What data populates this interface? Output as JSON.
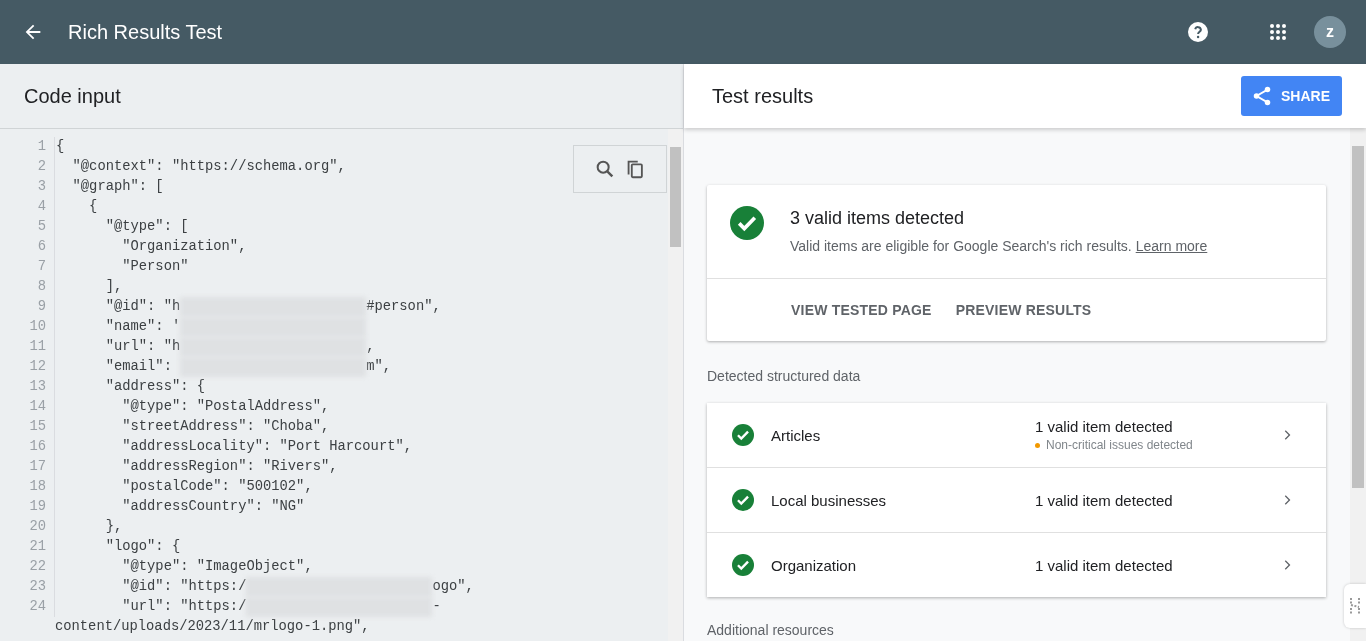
{
  "header": {
    "title": "Rich Results Test",
    "avatar": "z"
  },
  "code_panel": {
    "title": "Code input",
    "lines": [
      {
        "number": "1",
        "parts": [
          {
            "kind": "code",
            "text": "{"
          }
        ]
      },
      {
        "number": "2",
        "parts": [
          {
            "kind": "code",
            "text": "  \"@context\": \"https://schema.org\","
          }
        ]
      },
      {
        "number": "3",
        "parts": [
          {
            "kind": "code",
            "text": "  \"@graph\": ["
          }
        ]
      },
      {
        "number": "4",
        "parts": [
          {
            "kind": "code",
            "text": "    {"
          }
        ]
      },
      {
        "number": "5",
        "parts": [
          {
            "kind": "code",
            "text": "      \"@type\": ["
          }
        ]
      },
      {
        "number": "6",
        "parts": [
          {
            "kind": "code",
            "text": "        \"Organization\","
          }
        ]
      },
      {
        "number": "7",
        "parts": [
          {
            "kind": "code",
            "text": "        \"Person\""
          }
        ]
      },
      {
        "number": "8",
        "parts": [
          {
            "kind": "code",
            "text": "      ],"
          }
        ]
      },
      {
        "number": "9",
        "parts": [
          {
            "kind": "code",
            "text": "      \"@id\": \"h"
          },
          {
            "kind": "redacted"
          },
          {
            "kind": "code",
            "text": "#person\","
          }
        ]
      },
      {
        "number": "10",
        "parts": [
          {
            "kind": "code",
            "text": "      \"name\": '"
          },
          {
            "kind": "redacted"
          }
        ]
      },
      {
        "number": "11",
        "parts": [
          {
            "kind": "code",
            "text": "      \"url\": \"h"
          },
          {
            "kind": "redacted"
          },
          {
            "kind": "code",
            "text": ","
          }
        ]
      },
      {
        "number": "12",
        "parts": [
          {
            "kind": "code",
            "text": "      \"email\": "
          },
          {
            "kind": "redacted"
          },
          {
            "kind": "code",
            "text": "m\","
          }
        ]
      },
      {
        "number": "13",
        "parts": [
          {
            "kind": "code",
            "text": "      \"address\": {"
          }
        ]
      },
      {
        "number": "14",
        "parts": [
          {
            "kind": "code",
            "text": "        \"@type\": \"PostalAddress\","
          }
        ]
      },
      {
        "number": "15",
        "parts": [
          {
            "kind": "code",
            "text": "        \"streetAddress\": \"Choba\","
          }
        ]
      },
      {
        "number": "16",
        "parts": [
          {
            "kind": "code",
            "text": "        \"addressLocality\": \"Port Harcourt\","
          }
        ]
      },
      {
        "number": "17",
        "parts": [
          {
            "kind": "code",
            "text": "        \"addressRegion\": \"Rivers\","
          }
        ]
      },
      {
        "number": "18",
        "parts": [
          {
            "kind": "code",
            "text": "        \"postalCode\": \"500102\","
          }
        ]
      },
      {
        "number": "19",
        "parts": [
          {
            "kind": "code",
            "text": "        \"addressCountry\": \"NG\""
          }
        ]
      },
      {
        "number": "20",
        "parts": [
          {
            "kind": "code",
            "text": "      },"
          }
        ]
      },
      {
        "number": "21",
        "parts": [
          {
            "kind": "code",
            "text": "      \"logo\": {"
          }
        ]
      },
      {
        "number": "22",
        "parts": [
          {
            "kind": "code",
            "text": "        \"@type\": \"ImageObject\","
          }
        ]
      },
      {
        "number": "23",
        "parts": [
          {
            "kind": "code",
            "text": "        \"@id\": \"https:/"
          },
          {
            "kind": "redacted"
          },
          {
            "kind": "code",
            "text": "ogo\","
          }
        ]
      },
      {
        "number": "24",
        "parts": [
          {
            "kind": "code",
            "text": "        \"url\": \"https:/"
          },
          {
            "kind": "redacted"
          },
          {
            "kind": "code",
            "text": "-"
          }
        ],
        "wrap": "content/uploads/2023/11/mrlogo-1.png\","
      }
    ]
  },
  "results": {
    "title": "Test results",
    "share": "SHARE",
    "summary": {
      "heading": "3 valid items detected",
      "text": "Valid items are eligible for Google Search's rich results.",
      "link": "Learn more",
      "actions": [
        "VIEW TESTED PAGE",
        "PREVIEW RESULTS"
      ]
    },
    "section_label": "Detected structured data",
    "items": [
      {
        "name": "Articles",
        "status": "1 valid item detected",
        "note": {
          "text": "Non-critical issues detected",
          "color": "#f29900"
        }
      },
      {
        "name": "Local businesses",
        "status": "1 valid item detected"
      },
      {
        "name": "Organization",
        "status": "1 valid item detected"
      }
    ],
    "footer_label": "Additional resources"
  }
}
